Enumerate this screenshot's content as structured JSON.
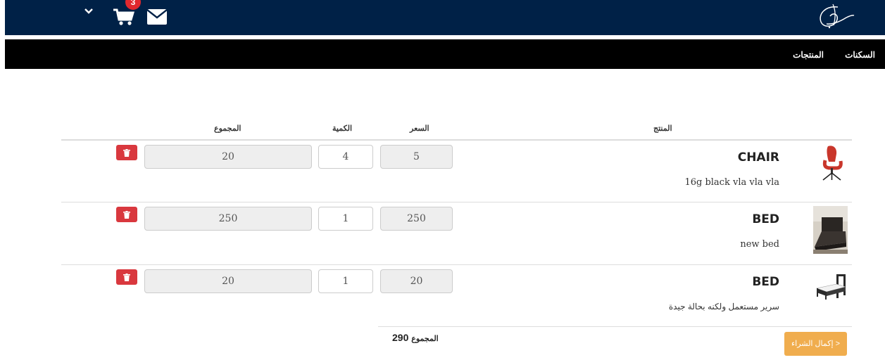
{
  "header": {
    "cart_count": "3",
    "icons": [
      "chevron-down-icon",
      "cart-icon",
      "envelope-icon",
      "calligraphy-logo"
    ],
    "colors": {
      "topbar": "#002147",
      "navbar": "#000000",
      "badge": "#e0282e"
    }
  },
  "nav": {
    "items": [
      {
        "label": "السكنات"
      },
      {
        "label": "المنتجات"
      }
    ]
  },
  "table": {
    "headers": {
      "product": "المنتج",
      "price": "السعر",
      "quantity": "الكمية",
      "total": "المجموع"
    },
    "rows": [
      {
        "name": "CHAIR",
        "description": "16g black vla vla vla",
        "price": "5",
        "quantity": "4",
        "total": "20",
        "image": "office-chair"
      },
      {
        "name": "BED",
        "description": "new bed",
        "price": "250",
        "quantity": "1",
        "total": "250",
        "image": "bed-photo"
      },
      {
        "name": "BED",
        "description": "سرير مستعمل ولكنه بحالة جيدة",
        "price": "20",
        "quantity": "1",
        "total": "20",
        "image": "bed-frame"
      }
    ]
  },
  "summary": {
    "total_label": "المجموع",
    "total_value": "290",
    "checkout_label": "< إكمال الشراء",
    "checkout_color": "#f0ad4e",
    "delete_color": "#d9383e"
  }
}
